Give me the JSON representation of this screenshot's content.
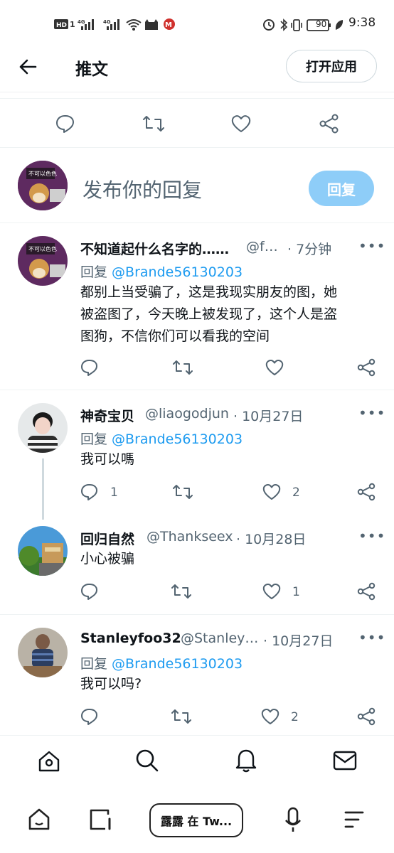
{
  "status_bar": {
    "time": "9:38",
    "battery": "90",
    "left_icons": [
      "hd-icon",
      "signal-4g-icon",
      "signal-4g-icon",
      "wifi-icon",
      "app-icon",
      "app-icon"
    ],
    "right_icons": [
      "alarm-icon",
      "bluetooth-icon",
      "vibrate-icon",
      "battery-icon",
      "leaf-icon"
    ]
  },
  "header": {
    "title": "推文",
    "open_app": "打开应用"
  },
  "composer": {
    "placeholder": "发布你的回复",
    "reply_button": "回复"
  },
  "tweets": [
    {
      "name": "不知道起什么名字的……",
      "handle": "@f…",
      "time": "· 7分钟",
      "reply_prefix": "回复 ",
      "reply_to": "@Brande56130203",
      "body_lines": [
        "都别上当受骗了，这是我现实朋友的图，她",
        "被盗图了，今天晚上被发现了，这个人是盗",
        "图狗，不信你们可以看我的空间"
      ],
      "reply_count": "",
      "like_count": ""
    },
    {
      "name": "神奇宝贝",
      "handle": "@liaogodjun",
      "time": "· 10月27日",
      "reply_prefix": "回复 ",
      "reply_to": "@Brande56130203",
      "body_lines": [
        "我可以嗎"
      ],
      "reply_count": "1",
      "like_count": "2"
    },
    {
      "name": "回归自然",
      "handle": "@Thankseex",
      "time": "· 10月28日",
      "body_lines": [
        "小心被骗"
      ],
      "reply_count": "",
      "like_count": "1"
    },
    {
      "name": "Stanleyfoo32",
      "handle": "@Stanley…",
      "time": "· 10月27日",
      "reply_prefix": "回复 ",
      "reply_to": "@Brande56130203",
      "body_lines": [
        "我可以吗?"
      ],
      "reply_count": "",
      "like_count": "2"
    }
  ],
  "more": "•••",
  "system_nav": {
    "pill_label": "露露 在 Tw..."
  },
  "colors": {
    "accent": "#1d9bf0",
    "reply_button_bg": "#8ecdf8",
    "secondary_text": "#536471"
  }
}
